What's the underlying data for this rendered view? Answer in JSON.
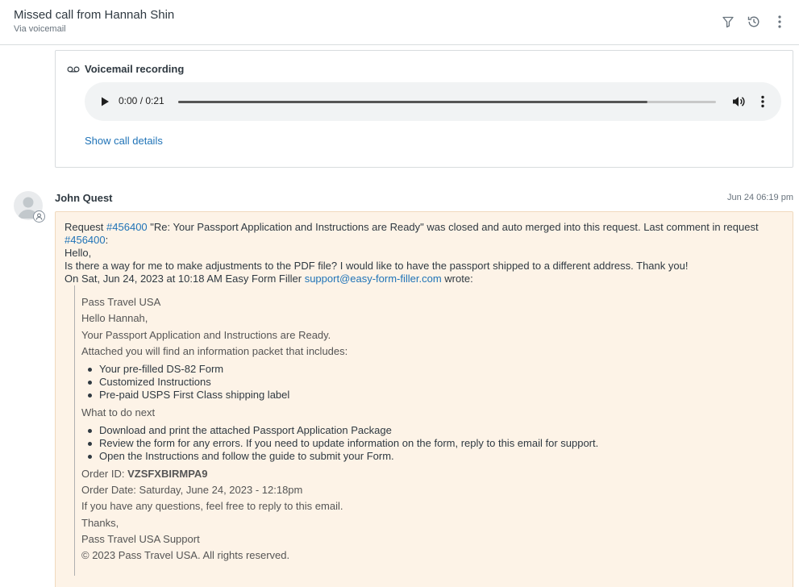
{
  "header": {
    "title": "Missed call from Hannah Shin",
    "subtitle": "Via voicemail",
    "icons": [
      "filter-icon",
      "history-icon",
      "more-vertical-icon"
    ]
  },
  "voicemail": {
    "heading": "Voicemail recording",
    "player": {
      "time": "0:00 / 0:21",
      "buffered_fraction": 0.873
    },
    "show_details_label": "Show call details"
  },
  "comment": {
    "author": "John Quest",
    "timestamp": "Jun 24 06:19 pm",
    "intro": {
      "prefix": "Request ",
      "request_link": "#456400",
      "middle": " \"Re: Your Passport Application and Instructions are Ready\" was closed and auto merged into this request. Last comment in request ",
      "request_link_2": "#456400",
      "suffix": ":"
    },
    "greeting": "Hello,",
    "message": "Is there a way for me to make adjustments to the PDF file? I would like to have the passport shipped to a different address. Thank you!",
    "wrote_prefix": "On Sat, Jun 24, 2023 at 10:18 AM Easy Form Filler ",
    "wrote_email": "support@easy-form-filler.com",
    "wrote_suffix": " wrote:",
    "quoted": {
      "company": "Pass Travel USA",
      "salutation": "Hello Hannah,",
      "ready": "Your Passport Application and Instructions are Ready.",
      "attached": "Attached you will find an information packet that includes:",
      "packet_items": [
        "Your pre-filled DS-82 Form",
        "Customized Instructions",
        "Pre-paid USPS First Class shipping label"
      ],
      "next_heading": "What to do next",
      "next_items": [
        "Download and print the attached Passport Application Package",
        "Review the form for any errors. If you need to update information on the form, reply to this email for support.",
        "Open the Instructions and follow the guide to submit your Form."
      ],
      "order_id_label": "Order ID: ",
      "order_id": "VZSFXBIRMPA9",
      "order_date": "Order Date: Saturday, June 24, 2023 - 12:18pm",
      "questions": "If you have any questions, feel free to reply to this email.",
      "thanks": "Thanks,",
      "signature": "Pass Travel USA Support",
      "copyright": "© 2023 Pass Travel USA. All rights reserved."
    }
  }
}
